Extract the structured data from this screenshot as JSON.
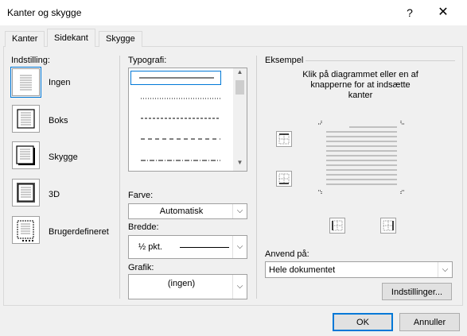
{
  "window": {
    "title": "Kanter og skygge",
    "help": "?",
    "close": "✕"
  },
  "tabs": [
    {
      "label": "Kanter",
      "active": false
    },
    {
      "label": "Sidekant",
      "active": true
    },
    {
      "label": "Skygge",
      "active": false
    }
  ],
  "settings": {
    "heading": "Indstilling:",
    "items": [
      {
        "label": "Ingen",
        "icon": "setting-none-icon",
        "selected": true
      },
      {
        "label": "Boks",
        "icon": "setting-box-icon",
        "selected": false
      },
      {
        "label": "Skygge",
        "icon": "setting-shadow-icon",
        "selected": false
      },
      {
        "label": "3D",
        "icon": "setting-3d-icon",
        "selected": false
      },
      {
        "label": "Brugerdefineret",
        "icon": "setting-custom-icon",
        "selected": false
      }
    ]
  },
  "typography": {
    "heading": "Typografi:",
    "styles": [
      "solid",
      "dotted",
      "dashed-small",
      "dashed-large",
      "dash-dot"
    ],
    "selected_index": 0
  },
  "color": {
    "label": "Farve:",
    "value": "Automatisk"
  },
  "width": {
    "label": "Bredde:",
    "value": "½ pkt."
  },
  "art": {
    "label": "Grafik:",
    "value": "(ingen)"
  },
  "preview": {
    "heading": "Eksempel",
    "instructions": [
      "Klik på diagrammet eller en af",
      "knapperne for at indsætte",
      "kanter"
    ]
  },
  "apply_to": {
    "label": "Anvend på:",
    "value": "Hele dokumentet"
  },
  "options_button": "Indstillinger...",
  "footer": {
    "ok": "OK",
    "cancel": "Annuller"
  },
  "colors": {
    "accent": "#0078d7",
    "panel": "#f0f0f0",
    "border": "#a0a0a0"
  }
}
